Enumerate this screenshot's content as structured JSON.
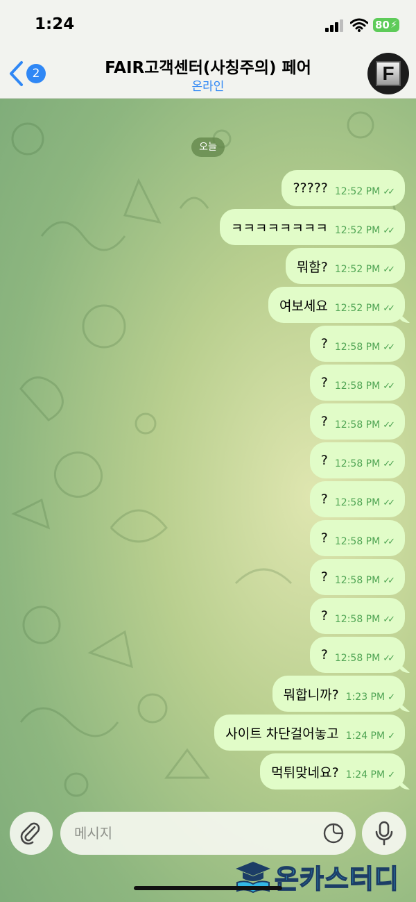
{
  "status_bar": {
    "time": "1:24",
    "battery_level": "80",
    "battery_color": "#5ecb59"
  },
  "header": {
    "back_badge_count": "2",
    "title": "FAIR고객센터(사칭주의) 페어",
    "status": "온라인",
    "avatar_letter": "F",
    "accent_color": "#2f87f5"
  },
  "chat": {
    "date_separator": "오늘",
    "bubble_color": "#e1fcc8",
    "messages": [
      {
        "text": "?????",
        "time": "12:52 PM",
        "status": "read"
      },
      {
        "text": "ㅋㅋㅋㅋㅋㅋㅋㅋ",
        "time": "12:52 PM",
        "status": "read"
      },
      {
        "text": "뭐함?",
        "time": "12:52 PM",
        "status": "read"
      },
      {
        "text": "여보세요",
        "time": "12:52 PM",
        "status": "read"
      },
      {
        "text": "?",
        "time": "12:58 PM",
        "status": "read"
      },
      {
        "text": "?",
        "time": "12:58 PM",
        "status": "read"
      },
      {
        "text": "?",
        "time": "12:58 PM",
        "status": "read"
      },
      {
        "text": "?",
        "time": "12:58 PM",
        "status": "read"
      },
      {
        "text": "?",
        "time": "12:58 PM",
        "status": "read"
      },
      {
        "text": "?",
        "time": "12:58 PM",
        "status": "read"
      },
      {
        "text": "?",
        "time": "12:58 PM",
        "status": "read"
      },
      {
        "text": "?",
        "time": "12:58 PM",
        "status": "read"
      },
      {
        "text": "?",
        "time": "12:58 PM",
        "status": "read"
      },
      {
        "text": "뭐합니까?",
        "time": "1:23 PM",
        "status": "sent"
      },
      {
        "text": "사이트 차단걸어놓고",
        "time": "1:24 PM",
        "status": "sent"
      },
      {
        "text": "먹튀맞네요?",
        "time": "1:24 PM",
        "status": "sent"
      }
    ]
  },
  "input": {
    "placeholder": "메시지",
    "attach_icon": "paperclip-icon",
    "sticker_icon": "sticker-icon",
    "mic_icon": "microphone-icon"
  },
  "watermark": {
    "text": "온카스터디"
  }
}
